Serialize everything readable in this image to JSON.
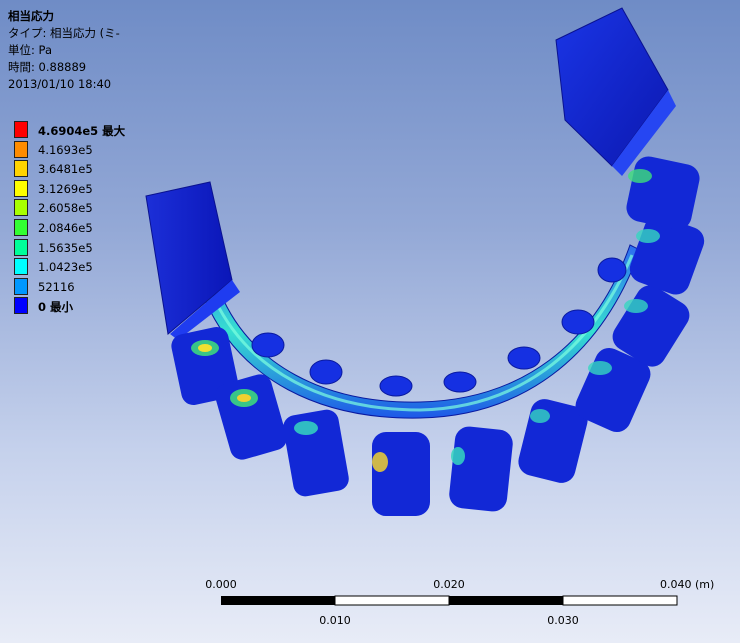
{
  "info": {
    "title": "相当応力",
    "type": "タイプ: 相当応力 (ミ-",
    "unit": "単位: Pa",
    "time": "時間: 0.88889",
    "date": "2013/01/10 18:40"
  },
  "legend": [
    {
      "label": "4.6904e5 最大",
      "color": "#ff0000",
      "bold": true
    },
    {
      "label": "4.1693e5",
      "color": "#ff8c00",
      "bold": false
    },
    {
      "label": "3.6481e5",
      "color": "#ffd400",
      "bold": false
    },
    {
      "label": "3.1269e5",
      "color": "#ffff00",
      "bold": false
    },
    {
      "label": "2.6058e5",
      "color": "#a8ff00",
      "bold": false
    },
    {
      "label": "2.0846e5",
      "color": "#33ff33",
      "bold": false
    },
    {
      "label": "1.5635e5",
      "color": "#00ff9a",
      "bold": false
    },
    {
      "label": "1.0423e5",
      "color": "#00ffff",
      "bold": false
    },
    {
      "label": "52116",
      "color": "#0098ff",
      "bold": false
    },
    {
      "label": "0 最小",
      "color": "#0000ff",
      "bold": true
    }
  ],
  "scale": {
    "top_labels": [
      "0.000",
      "0.020",
      "0.040 (m)"
    ],
    "bottom_labels": [
      "0.010",
      "0.030"
    ]
  }
}
